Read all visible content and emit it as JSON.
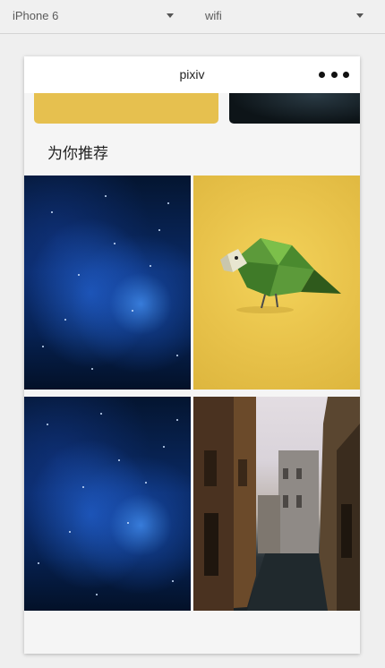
{
  "toolbar": {
    "device_label": "iPhone 6",
    "network_label": "wifi"
  },
  "app": {
    "title": "pixiv",
    "more_icon": "more-dots-icon"
  },
  "banner": {
    "items": [
      {
        "color": "#e6c04f",
        "kind": "yellow"
      },
      {
        "color": "#1a252b",
        "kind": "dark-photo"
      }
    ]
  },
  "recommend": {
    "heading": "为你推荐",
    "cards": [
      {
        "image": "starry-space-photo"
      },
      {
        "image": "low-poly-bird-illustration"
      },
      {
        "image": "starry-space-photo"
      },
      {
        "image": "old-town-street-photo",
        "selected": true
      }
    ]
  },
  "colors": {
    "selected_outline": "#d11a1a",
    "accent_yellow": "#e8c24a"
  }
}
